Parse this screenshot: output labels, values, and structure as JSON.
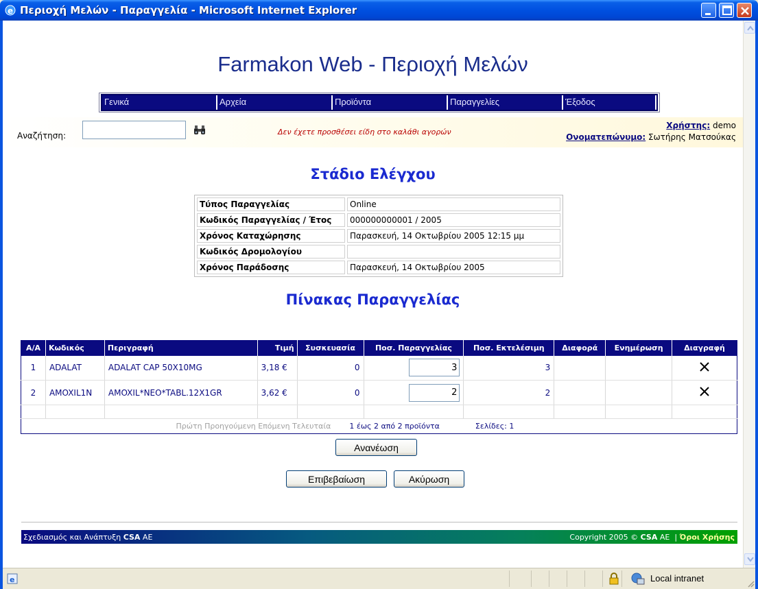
{
  "window": {
    "title": "Περιοχή Μελών - Παραγγελία - Microsoft Internet Explorer"
  },
  "site": {
    "title": "Farmakon Web - Περιοχή Μελών"
  },
  "menu": [
    "Γενικά",
    "Αρχεία",
    "Προϊόντα",
    "Παραγγελίες",
    "Έξοδος"
  ],
  "search": {
    "label": "Αναζήτηση:",
    "value": "",
    "cart_message": "Δεν έχετε προσθέσει είδη στο καλάθι αγορών"
  },
  "user": {
    "user_label": "Χρήστης:",
    "user": "demo",
    "name_label": "Ονοματεπώνυμο:",
    "name": "Σωτήρης Ματσούκας"
  },
  "check_stage": {
    "title": "Στάδιο Ελέγχου",
    "rows": [
      {
        "label": "Τύπος Παραγγελίας",
        "value": "Online"
      },
      {
        "label": "Κωδικός Παραγγελίας / Έτος",
        "value": "000000000001 / 2005"
      },
      {
        "label": "Χρόνος Καταχώρησης",
        "value": "Παρασκευή, 14 Οκτωβρίου 2005 12:15 μμ"
      },
      {
        "label": "Κωδικός Δρομολογίου",
        "value": ""
      },
      {
        "label": "Χρόνος Παράδοσης",
        "value": "Παρασκευή, 14 Οκτωβρίου 2005"
      }
    ]
  },
  "order": {
    "title": "Πίνακας Παραγγελίας",
    "columns": [
      "Α/Α",
      "Κωδικός",
      "Περιγραφή",
      "Τιμή",
      "Συσκευασία",
      "Ποσ. Παραγγελίας",
      "Ποσ. Εκτελέσιμη",
      "Διαφορά",
      "Ενημέρωση",
      "Διαγραφή"
    ],
    "rows": [
      {
        "aa": "1",
        "code": "ADALAT",
        "desc": "ADALAT CAP 50X10MG",
        "price": "3,18 €",
        "pack": "0",
        "qty": "3",
        "exec": "3",
        "diff": "",
        "update": ""
      },
      {
        "aa": "2",
        "code": "AMOXIL1N",
        "desc": "AMOXIL*NEO*TABL.12X1GR",
        "price": "3,62 €",
        "pack": "0",
        "qty": "2",
        "exec": "2",
        "diff": "",
        "update": ""
      }
    ],
    "pager": {
      "first": "Πρώτη",
      "prev": "Προηγούμενη",
      "next": "Επόμενη",
      "last": "Τελευταία",
      "range": "1 έως 2 από 2 προϊόντα",
      "pages": "Σελίδες: 1"
    }
  },
  "buttons": {
    "refresh": "Ανανέωση",
    "confirm": "Επιβεβαίωση",
    "cancel": "Ακύρωση"
  },
  "footer": {
    "left_prefix": "Σχεδιασμός και Ανάπτυξη ",
    "left_brand": "CSA",
    "left_suffix": " AE",
    "copyright_prefix": "Copyright 2005 © ",
    "copyright_brand": "CSA",
    "copyright_suffix": " AE",
    "terms": "Όροι Χρήσης"
  },
  "statusbar": {
    "zone": "Local intranet"
  },
  "colors": {
    "navy": "#0a0a80",
    "title_blue": "#1a2ad0",
    "alert_red": "#b80000"
  }
}
